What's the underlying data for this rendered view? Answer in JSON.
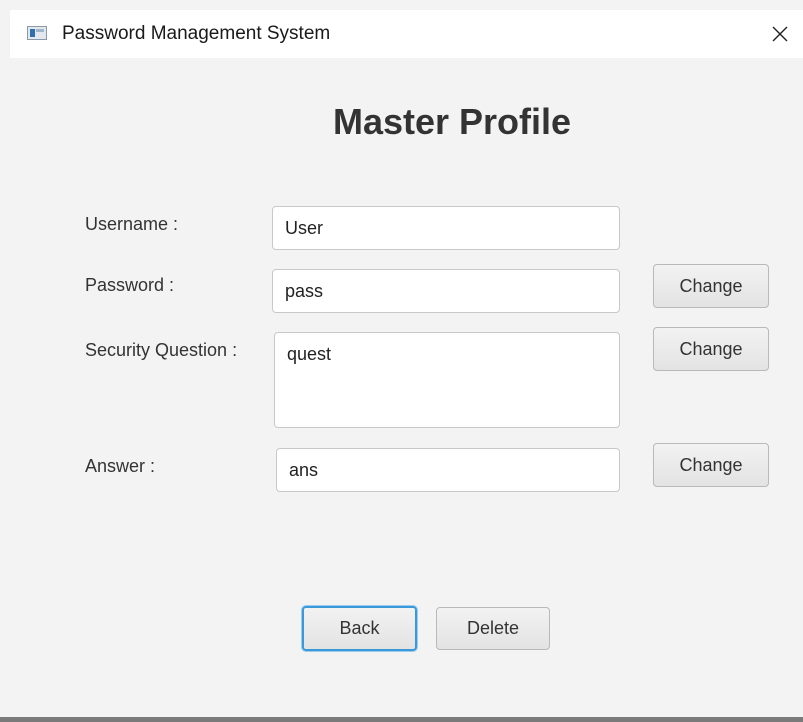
{
  "window": {
    "title": "Password Management System"
  },
  "main": {
    "heading": "Master Profile",
    "username": {
      "label": "Username :",
      "value": "User"
    },
    "password": {
      "label": "Password :",
      "value": "pass",
      "change_label": "Change"
    },
    "security_question": {
      "label": "Security Question :",
      "value": "quest",
      "change_label": "Change"
    },
    "answer": {
      "label": "Answer :",
      "value": "ans",
      "change_label": "Change"
    }
  },
  "footer": {
    "back_label": "Back",
    "delete_label": "Delete"
  },
  "icons": {
    "app": "app-window-icon",
    "close": "close-icon"
  },
  "colors": {
    "background": "#f3f3f3",
    "titlebar": "#ffffff",
    "focus_ring": "#3a9ad9",
    "text": "#333333"
  }
}
